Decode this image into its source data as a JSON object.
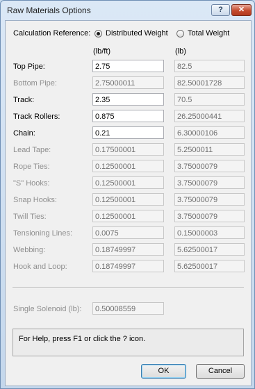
{
  "window": {
    "title": "Raw Materials Options",
    "help_glyph": "?",
    "close_glyph": "✕"
  },
  "calc": {
    "label": "Calculation Reference:",
    "option_distributed": "Distributed Weight",
    "option_total": "Total Weight",
    "selected": "Distributed Weight"
  },
  "units": {
    "distributed": "(lb/ft)",
    "total": "(lb)"
  },
  "rows": [
    {
      "label": "Top Pipe:",
      "dist": "2.75",
      "total": "82.5"
    },
    {
      "label": "Bottom Pipe:",
      "dist": "2.75000011",
      "total": "82.50001728"
    },
    {
      "label": "Track:",
      "dist": "2.35",
      "total": "70.5"
    },
    {
      "label": "Track Rollers:",
      "dist": "0.875",
      "total": "26.25000441"
    },
    {
      "label": "Chain:",
      "dist": "0.21",
      "total": "6.30000106"
    },
    {
      "label": "Lead Tape:",
      "dist": "0.17500001",
      "total": "5.2500011"
    },
    {
      "label": "Rope Ties:",
      "dist": "0.12500001",
      "total": "3.75000079"
    },
    {
      "label": "\"S\" Hooks:",
      "dist": "0.12500001",
      "total": "3.75000079"
    },
    {
      "label": "Snap Hooks:",
      "dist": "0.12500001",
      "total": "3.75000079"
    },
    {
      "label": "Twill Ties:",
      "dist": "0.12500001",
      "total": "3.75000079"
    },
    {
      "label": "Tensioning Lines:",
      "dist": "0.0075",
      "total": "0.15000003"
    },
    {
      "label": "Webbing:",
      "dist": "0.18749997",
      "total": "5.62500017"
    },
    {
      "label": "Hook and Loop:",
      "dist": "0.18749997",
      "total": "5.62500017"
    }
  ],
  "solenoid": {
    "label": "Single Solenoid (lb):",
    "value": "0.50008559"
  },
  "help_text": "For Help, press F1 or click the ? icon.",
  "buttons": {
    "ok": "OK",
    "cancel": "Cancel"
  }
}
